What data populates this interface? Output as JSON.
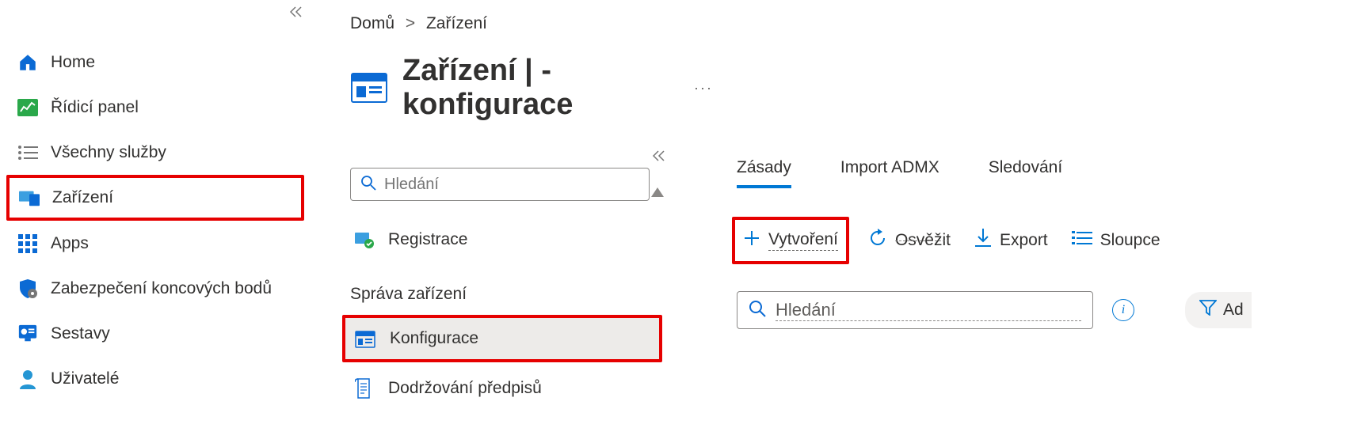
{
  "sidebar": {
    "items": [
      {
        "label": "Home"
      },
      {
        "label": "Řídicí panel"
      },
      {
        "label": "Všechny služby"
      },
      {
        "label": "Zařízení"
      },
      {
        "label": "Apps"
      },
      {
        "label": "Zabezpečení koncových bodů"
      },
      {
        "label": "Sestavy"
      },
      {
        "label": "Uživatelé"
      }
    ]
  },
  "breadcrumb": {
    "home": "Domů",
    "sep": ">",
    "current": "Zařízení"
  },
  "heading": "Zařízení | - konfigurace",
  "mid_search_placeholder": "Hledání",
  "mid_items": {
    "registration": "Registrace",
    "section_header": "Správa zařízení",
    "configuration": "Konfigurace",
    "compliance": "Dodržování předpisů"
  },
  "tabs": [
    {
      "label": "Zásady"
    },
    {
      "label": "Import ADMX"
    },
    {
      "label": "Sledování"
    }
  ],
  "toolbar": {
    "create": "Vytvoření",
    "refresh": "Osvěžit",
    "export": "Export",
    "columns": "Sloupce"
  },
  "right_search_placeholder": "Hledání",
  "filter_label": "Ad"
}
